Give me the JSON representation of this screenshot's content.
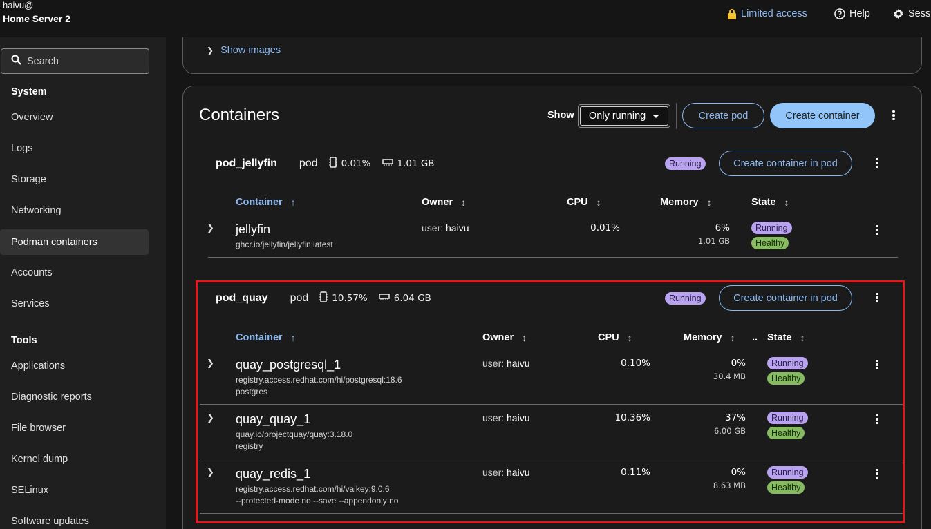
{
  "header": {
    "user": "haivu@",
    "host": "Home Server 2",
    "limited_access": "Limited access",
    "help": "Help",
    "session": "Sess"
  },
  "sidebar": {
    "search_placeholder": "Search",
    "system_heading": "System",
    "system_items": [
      "Overview",
      "Logs",
      "Storage",
      "Networking",
      "Podman containers",
      "Accounts",
      "Services"
    ],
    "tools_heading": "Tools",
    "tools_items": [
      "Applications",
      "Diagnostic reports",
      "File browser",
      "Kernel dump",
      "SELinux",
      "Software updates"
    ]
  },
  "images_card": {
    "show_images": "Show images"
  },
  "containers": {
    "title": "Containers",
    "show_label": "Show",
    "filter_value": "Only running",
    "create_pod": "Create pod",
    "create_container": "Create container"
  },
  "pods": [
    {
      "name": "pod_jellyfin",
      "label": "pod",
      "cpu": "0.01%",
      "memory": "1.01 GB",
      "status": "Running",
      "create_btn": "Create container in pod",
      "columns": {
        "container": "Container",
        "owner": "Owner",
        "cpu": "CPU",
        "memory": "Memory",
        "state": "State"
      },
      "rows": [
        {
          "name": "jellyfin",
          "image": "ghcr.io/jellyfin/jellyfin:latest",
          "cmd": "",
          "owner_prefix": "user:",
          "owner": "haivu",
          "cpu": "0.01%",
          "mem_pct": "6%",
          "mem": "1.01 GB",
          "state": "Running",
          "health": "Healthy"
        }
      ]
    },
    {
      "name": "pod_quay",
      "label": "pod",
      "cpu": "10.57%",
      "memory": "6.04 GB",
      "status": "Running",
      "create_btn": "Create container in pod",
      "columns": {
        "container": "Container",
        "owner": "Owner",
        "cpu": "CPU",
        "memory": "Memory",
        "extra": "..",
        "state": "State"
      },
      "rows": [
        {
          "name": "quay_postgresql_1",
          "image": "registry.access.redhat.com/hi/postgresql:18.6",
          "cmd": "postgres",
          "owner_prefix": "user:",
          "owner": "haivu",
          "cpu": "0.10%",
          "mem_pct": "0%",
          "mem": "30.4 MB",
          "state": "Running",
          "health": "Healthy"
        },
        {
          "name": "quay_quay_1",
          "image": "quay.io/projectquay/quay:3.18.0",
          "cmd": "registry",
          "owner_prefix": "user:",
          "owner": "haivu",
          "cpu": "10.36%",
          "mem_pct": "37%",
          "mem": "6.00 GB",
          "state": "Running",
          "health": "Healthy"
        },
        {
          "name": "quay_redis_1",
          "image": "registry.access.redhat.com/hi/valkey:9.0.6",
          "cmd": "--protected-mode no --save --appendonly no",
          "owner_prefix": "user:",
          "owner": "haivu",
          "cpu": "0.11%",
          "mem_pct": "0%",
          "mem": "8.63 MB",
          "state": "Running",
          "health": "Healthy"
        }
      ]
    }
  ],
  "colors": {
    "accent": "#8bb8f0",
    "primary_button": "#92c5f9",
    "running_badge": "#b9a3f0",
    "healthy_badge": "#87bb62",
    "highlight": "#e0191c"
  }
}
